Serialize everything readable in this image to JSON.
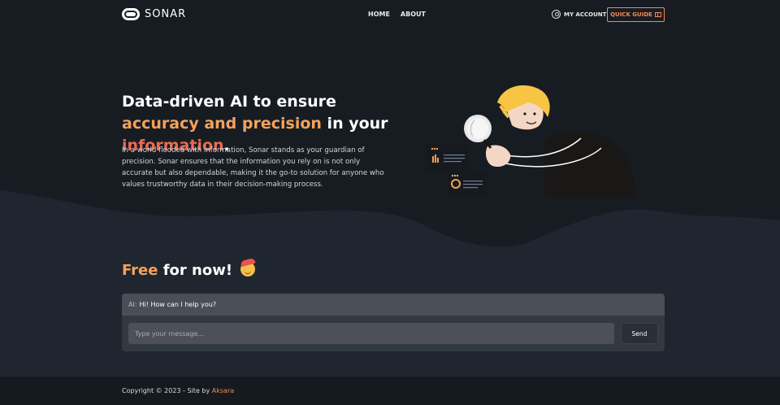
{
  "brand": {
    "name": "SONAR"
  },
  "nav": {
    "links": [
      "HOME",
      "ABOUT"
    ],
    "account_label": "MY ACCOUNT",
    "quick_guide_label": "QUICK GUIDE"
  },
  "hero": {
    "headline_part1": "Data-driven AI to ensure ",
    "headline_accent1": "accuracy and precision",
    "headline_part2": " in your ",
    "headline_accent2": "information",
    "headline_end": ".",
    "description": "In a world flooded with information, Sonar stands as your guardian of precision. Sonar ensures that the information you rely on is not only accurate but also dependable, making it the go-to solution for anyone who values trustworthy data in their decision-making process."
  },
  "free": {
    "accent": "Free",
    "rest": " for now!"
  },
  "chat": {
    "ai_label": "AI:",
    "ai_message": "Hi! How can I help you?",
    "input_placeholder": "Type your message...",
    "send_label": "Send"
  },
  "footer": {
    "copyright": "Copyright © 2023 - Site by ",
    "author": "Aksara"
  },
  "colors": {
    "accent_orange": "#f5a259",
    "accent_red": "#ec6a4e",
    "button_orange": "#f28b50",
    "nav_bg": "#171c23",
    "page_bg": "#1f2630"
  }
}
